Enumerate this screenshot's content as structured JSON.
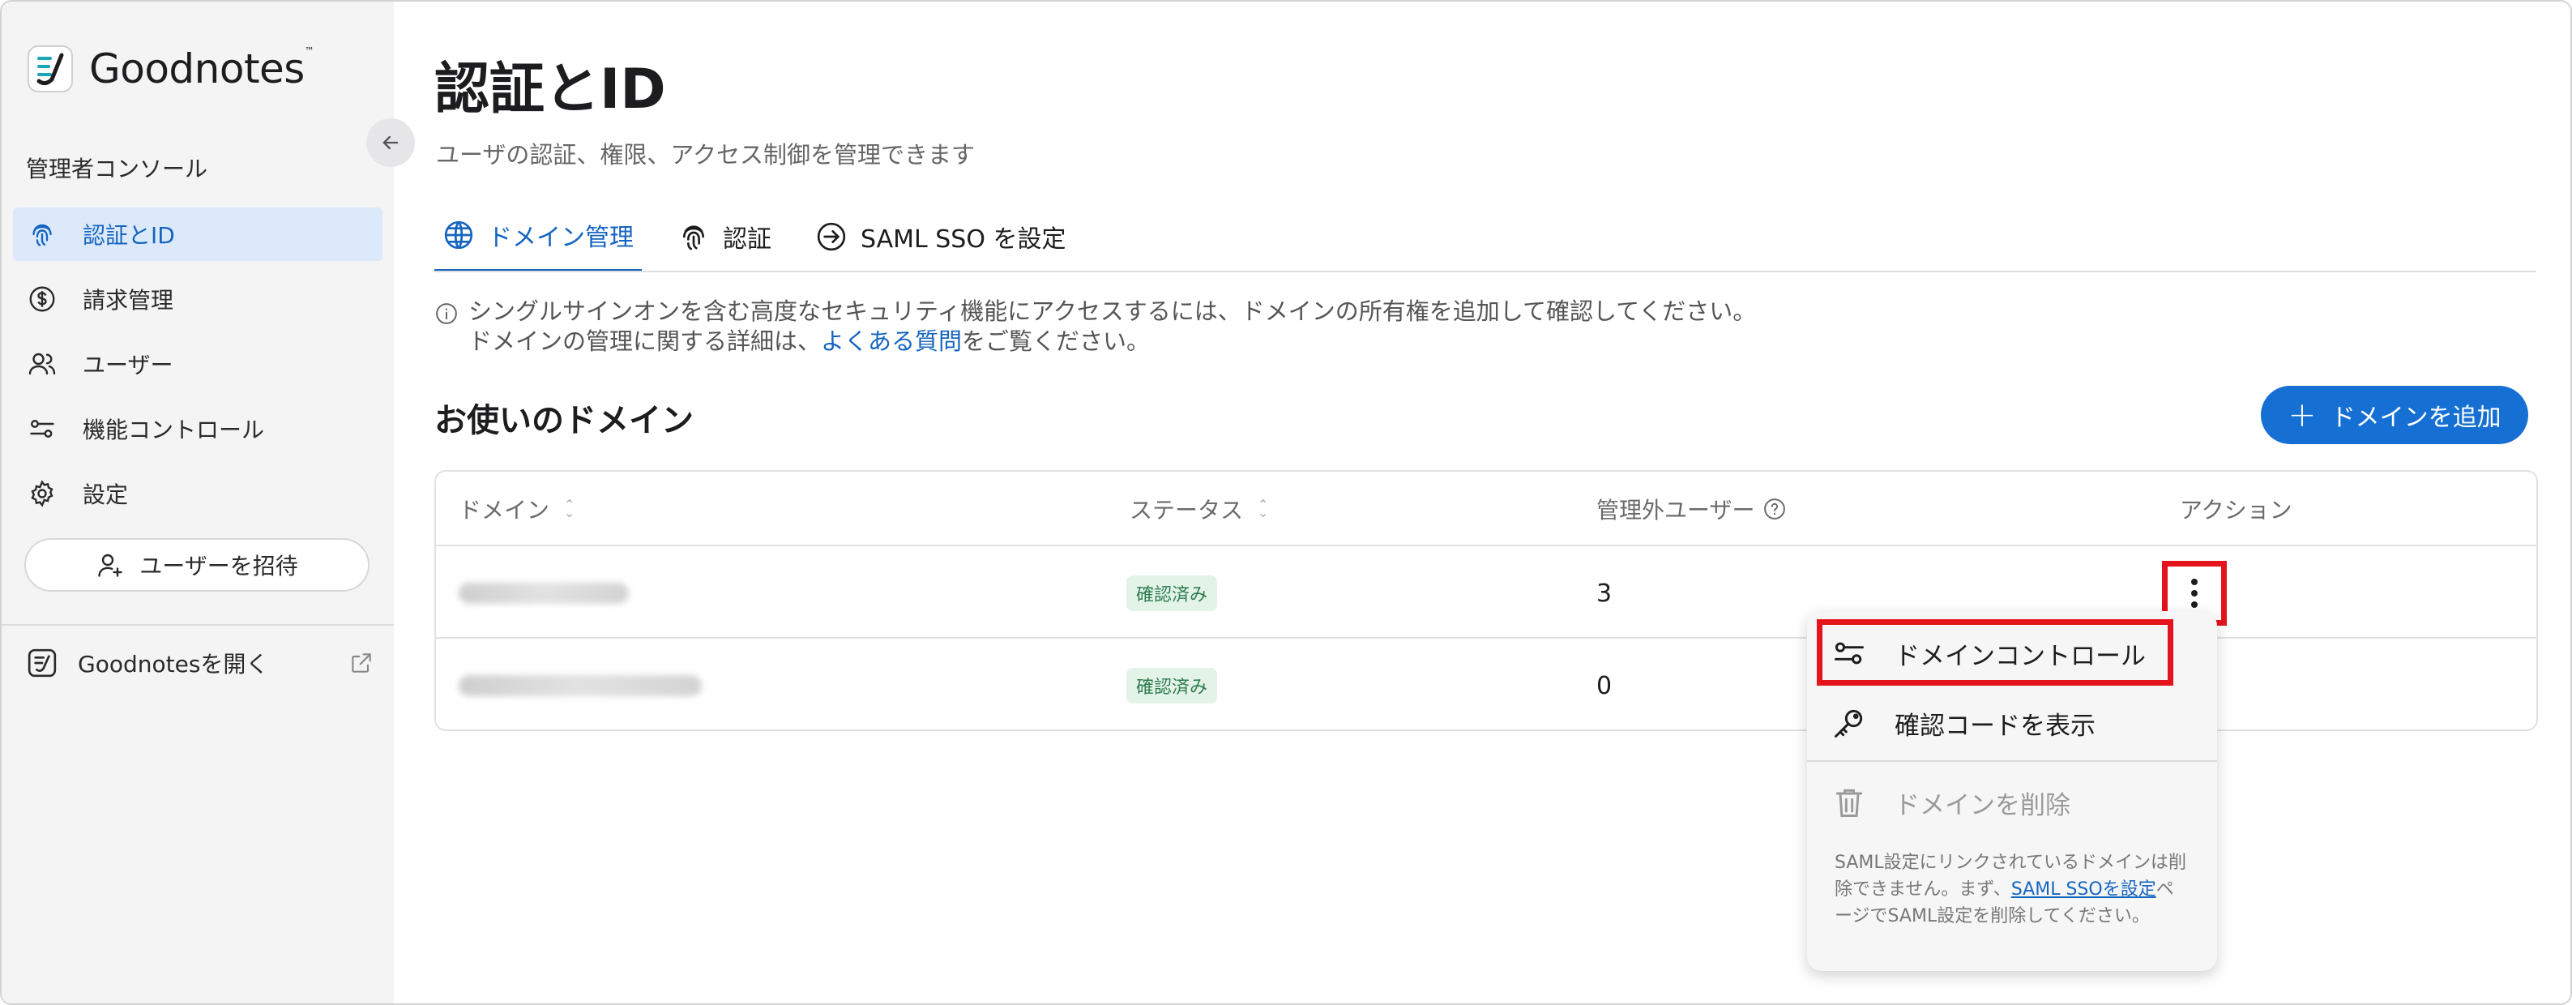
{
  "app": {
    "brand": "Goodnotes",
    "brand_tm": "™"
  },
  "sidebar": {
    "console_label": "管理者コンソール",
    "items": [
      {
        "label": "認証とID",
        "icon": "fingerprint-icon",
        "active": true
      },
      {
        "label": "請求管理",
        "icon": "dollar-circle-icon",
        "active": false
      },
      {
        "label": "ユーザー",
        "icon": "users-icon",
        "active": false
      },
      {
        "label": "機能コントロール",
        "icon": "toggle-controls-icon",
        "active": false
      },
      {
        "label": "設定",
        "icon": "gear-icon",
        "active": false
      }
    ],
    "invite_button": "ユーザーを招待",
    "open_app": "Goodnotesを開く"
  },
  "main": {
    "title": "認証とID",
    "subtitle": "ユーザの認証、権限、アクセス制御を管理できます",
    "tabs": [
      {
        "label": "ドメイン管理",
        "icon": "globe-icon",
        "active": true
      },
      {
        "label": "認証",
        "icon": "fingerprint-icon",
        "active": false
      },
      {
        "label": "SAML SSO を設定",
        "icon": "sign-in-icon",
        "active": false
      }
    ],
    "info_line1": "シングルサインオンを含む高度なセキュリティ機能にアクセスするには、ドメインの所有権を追加して確認してください。",
    "info_line2_prefix": "ドメインの管理に関する詳細は、",
    "info_link": "よくある質問",
    "info_line2_suffix": "をご覧ください。",
    "section_title": "お使いのドメイン",
    "add_button": "ドメインを追加"
  },
  "table": {
    "columns": {
      "domain": "ドメイン",
      "status": "ステータス",
      "unmanaged": "管理外ユーザー",
      "action": "アクション"
    },
    "rows": [
      {
        "status": "確認済み",
        "unmanaged": "3"
      },
      {
        "status": "確認済み",
        "unmanaged": "0"
      }
    ]
  },
  "menu": {
    "items": [
      {
        "label": "ドメインコントロール",
        "icon": "sliders-icon",
        "disabled": false
      },
      {
        "label": "確認コードを表示",
        "icon": "key-icon",
        "disabled": false
      },
      {
        "label": "ドメインを削除",
        "icon": "trash-icon",
        "disabled": true
      }
    ],
    "note_prefix": "SAML設定にリンクされているドメインは削除できません。まず、",
    "note_link": "SAML SSOを設定",
    "note_suffix": "ページでSAML設定を削除してください。"
  },
  "colors": {
    "accent": "#1670d3",
    "highlight": "#e5141c",
    "badge_bg": "#e3f3e8",
    "badge_text": "#2e7d4f"
  }
}
